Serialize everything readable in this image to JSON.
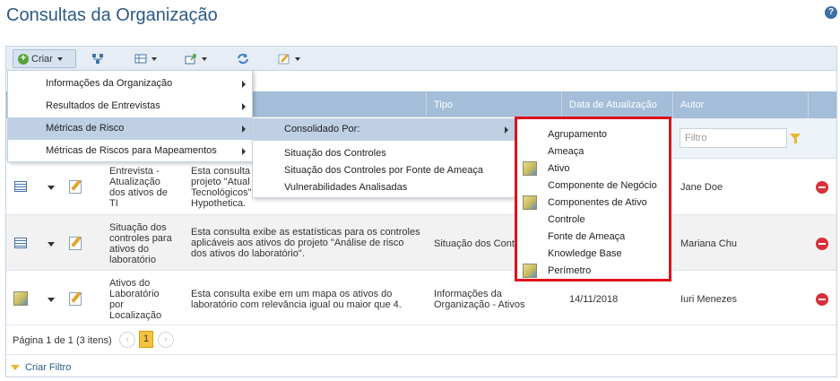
{
  "header": {
    "title": "Consultas da Organização",
    "help_icon": "question-icon"
  },
  "toolbar": {
    "create_label": "Criar",
    "icons": [
      "plus-icon",
      "hierarchy-icon",
      "column-config-icon",
      "export-icon",
      "refresh-icon",
      "edit-icon"
    ]
  },
  "table": {
    "columns": {
      "tipo": "Tipo",
      "data": "Data de Atualização",
      "autor": "Autor"
    },
    "filter_placeholder": "Filtro",
    "rows": [
      {
        "name": "Entrevista - Atualização dos ativos de TI",
        "description": "Esta consulta ... projeto \"Atual... Tecnológicos\" ... Hypothetica.",
        "type": "",
        "date": "",
        "author": "Jane Doe"
      },
      {
        "name": "Situação dos controles para ativos do laboratório",
        "description": "Esta consulta exibe as estatísticas para os controles aplicáveis aos ativos do projeto \"Análise de risco dos ativos do laboratório\".",
        "type": "Situação dos Cont",
        "date": "",
        "author": "Mariana Chu"
      },
      {
        "name": "Ativos do Laboratório por Localização",
        "description": "Esta consulta exibe em um mapa os ativos do laboratório com relevância igual ou maior que 4.",
        "type": "Informações da Organização - Ativos",
        "date": "14/11/2018",
        "author": "Iuri Menezes"
      }
    ],
    "row1_desc_lines": [
      "Esta consulta",
      "projeto \"Atual",
      "Tecnológicos\"",
      "Hypothetica."
    ],
    "row1_name_lines": [
      "Entrevista -",
      "Atualização",
      "dos ativos de",
      "TI"
    ],
    "row2_name_lines": [
      "Situação dos",
      "controles para",
      "ativos do",
      "laboratório"
    ],
    "row2_desc_lines": [
      "Esta consulta exibe as estatísticas para os controles",
      "aplicáveis aos ativos do projeto \"Análise de risco",
      "dos ativos do laboratório\"."
    ],
    "row3_name_lines": [
      "Ativos do",
      "Laboratório",
      "por",
      "Localização"
    ],
    "row3_desc_lines": [
      "Esta consulta exibe em um mapa os ativos do",
      "laboratório com relevância igual ou maior que 4."
    ],
    "row3_type_lines": [
      "Informações da",
      "Organização - Ativos"
    ]
  },
  "pager": {
    "text": "Página 1 de 1 (3 itens)",
    "current_page": "1",
    "prev": "‹",
    "next": "›"
  },
  "footer": {
    "create_filter": "Criar Filtro"
  },
  "menu": {
    "items": [
      "Informações da Organização",
      "Resultados de Entrevistas",
      "Métricas de Risco",
      "Métricas de Riscos para Mapeamentos"
    ]
  },
  "submenu": {
    "items": [
      "Consolidado Por:",
      "Situação dos Controles",
      "Situação dos Controles por Fonte de Ameaça",
      "Vulnerabilidades Analisadas"
    ]
  },
  "submenu2": {
    "items": [
      "Agrupamento",
      "Ameaça",
      "Ativo",
      "Componente de Negócio",
      "Componentes de Ativo",
      "Controle",
      "Fonte de Ameaça",
      "Knowledge Base",
      "Perímetro"
    ]
  },
  "colors": {
    "title": "#2b5a8a",
    "header_bg": "#a4bdd8",
    "highlight_border": "#e0101d",
    "page_active": "#f5c23d"
  }
}
